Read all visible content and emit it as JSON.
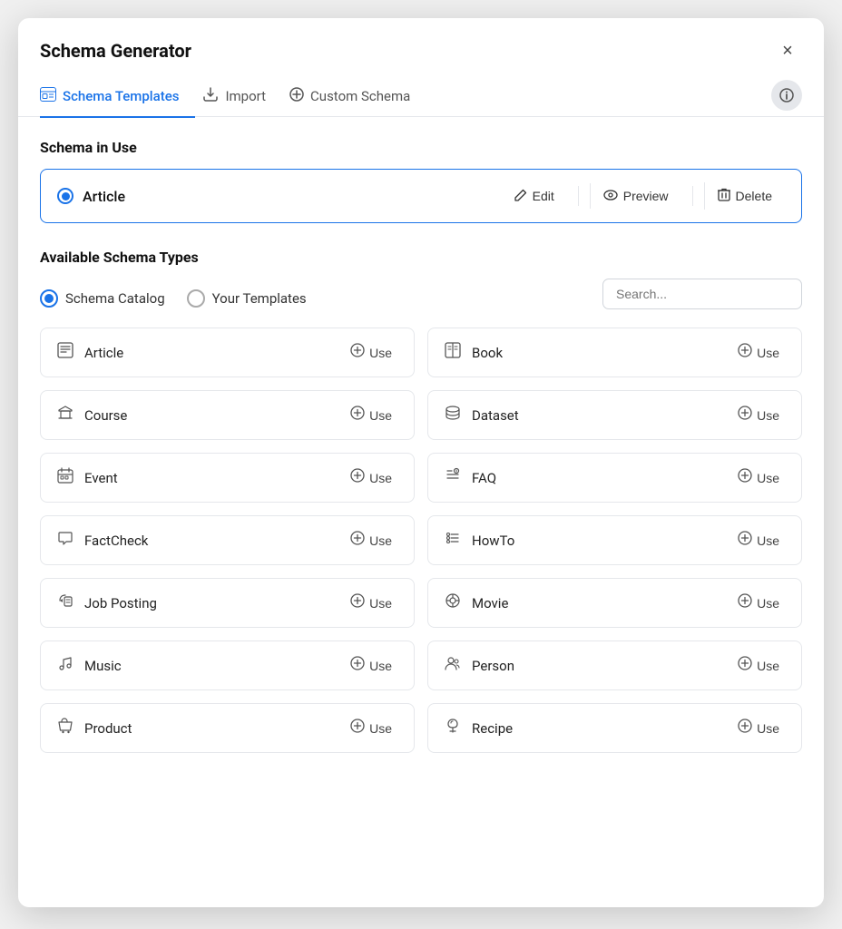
{
  "modal": {
    "title": "Schema Generator",
    "close_label": "×"
  },
  "tabs": [
    {
      "id": "schema-templates",
      "label": "Schema Templates",
      "icon": "🗂",
      "active": true
    },
    {
      "id": "import",
      "label": "Import",
      "icon": "⬇",
      "active": false
    },
    {
      "id": "custom-schema",
      "label": "Custom Schema",
      "icon": "⊕",
      "active": false
    }
  ],
  "info_btn_label": "ℹ",
  "schema_in_use": {
    "section_label": "Schema in Use",
    "name": "Article",
    "edit_label": "Edit",
    "preview_label": "Preview",
    "delete_label": "Delete"
  },
  "available_schema": {
    "section_label": "Available Schema Types",
    "filters": [
      {
        "id": "schema-catalog",
        "label": "Schema Catalog",
        "selected": true
      },
      {
        "id": "your-templates",
        "label": "Your Templates",
        "selected": false
      }
    ],
    "search_placeholder": "Search...",
    "items": [
      {
        "id": "article",
        "label": "Article",
        "icon": "📄",
        "use_label": "Use"
      },
      {
        "id": "book",
        "label": "Book",
        "icon": "📖",
        "use_label": "Use"
      },
      {
        "id": "course",
        "label": "Course",
        "icon": "🎓",
        "use_label": "Use"
      },
      {
        "id": "dataset",
        "label": "Dataset",
        "icon": "🗄",
        "use_label": "Use"
      },
      {
        "id": "event",
        "label": "Event",
        "icon": "📅",
        "use_label": "Use"
      },
      {
        "id": "faq",
        "label": "FAQ",
        "icon": "📋",
        "use_label": "Use"
      },
      {
        "id": "factcheck",
        "label": "FactCheck",
        "icon": "💬",
        "use_label": "Use"
      },
      {
        "id": "howto",
        "label": "HowTo",
        "icon": "📝",
        "use_label": "Use"
      },
      {
        "id": "job-posting",
        "label": "Job Posting",
        "icon": "📢",
        "use_label": "Use"
      },
      {
        "id": "movie",
        "label": "Movie",
        "icon": "🎬",
        "use_label": "Use"
      },
      {
        "id": "music",
        "label": "Music",
        "icon": "🎵",
        "use_label": "Use"
      },
      {
        "id": "person",
        "label": "Person",
        "icon": "👤",
        "use_label": "Use"
      },
      {
        "id": "product",
        "label": "Product",
        "icon": "🛒",
        "use_label": "Use"
      },
      {
        "id": "recipe",
        "label": "Recipe",
        "icon": "🍽",
        "use_label": "Use"
      }
    ]
  },
  "icons": {
    "edit": "✏",
    "preview": "👁",
    "delete": "🗑",
    "use": "⊕",
    "close": "✕",
    "info": "ℹ",
    "search": "🔍"
  }
}
